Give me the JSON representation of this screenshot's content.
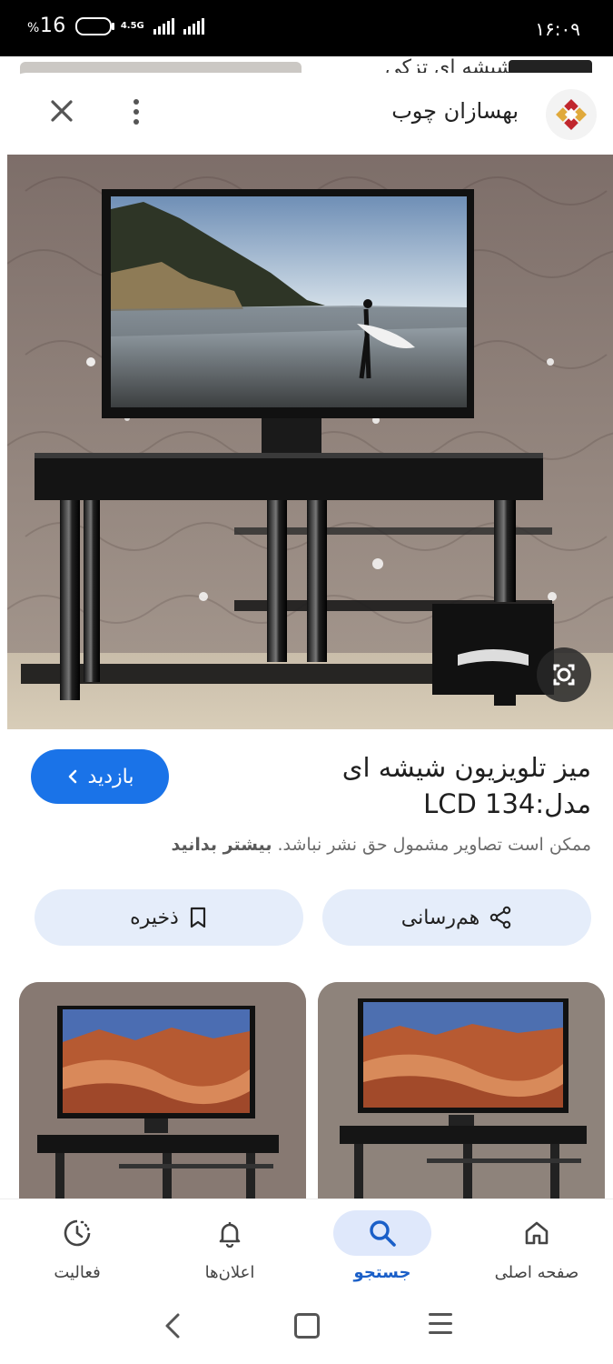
{
  "status_bar": {
    "battery": "16",
    "battery_symbol": "%",
    "network": "4.5G",
    "time": "۱۶:۰۹"
  },
  "background": {
    "partial_text": "شیشه ای تزکی"
  },
  "sheet": {
    "site_name": "بهسازان چوب",
    "close_icon": "close-icon",
    "more_icon": "more-vert-icon"
  },
  "result": {
    "title": "میز تلویزیون شیشه ای مدل:LCD 134",
    "visit_label": "بازدید",
    "copyright_text": "ممکن است تصاویر مشمول حق نشر نباشد.",
    "learn_more": "بیشتر بدانید",
    "share_label": "هم‌رسانی",
    "save_label": "ذخیره"
  },
  "bottom_nav": {
    "items": [
      {
        "label": "صفحه اصلی",
        "icon": "home-icon"
      },
      {
        "label": "جستجو",
        "icon": "search-icon",
        "active": true
      },
      {
        "label": "اعلان‌ها",
        "icon": "bell-icon"
      },
      {
        "label": "فعالیت",
        "icon": "activity-icon"
      }
    ]
  },
  "colors": {
    "accent": "#1a73e8",
    "action_bg": "#e5edfa",
    "active_nav_bg": "#dfe8fb"
  }
}
